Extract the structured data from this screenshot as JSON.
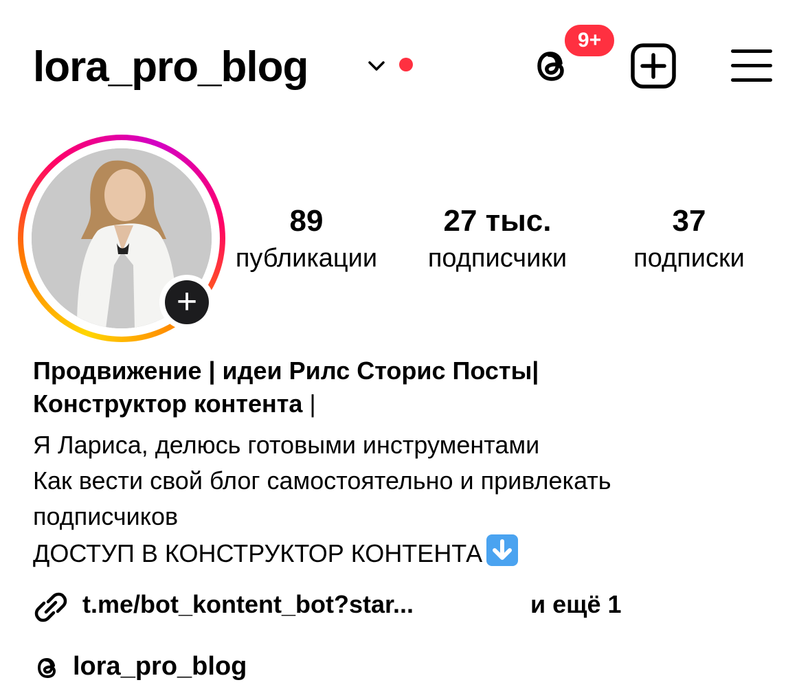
{
  "header": {
    "username": "lora_pro_blog",
    "notification_badge": "9+",
    "icons": {
      "account_switch": "chevron-down-icon",
      "threads": "threads-icon",
      "create": "plus-square-icon",
      "menu": "hamburger-menu-icon"
    },
    "colors": {
      "accent_red": "#ff3040"
    }
  },
  "profile": {
    "avatar_icon": "profile-avatar",
    "add_story_symbol": "+"
  },
  "stats": {
    "posts": {
      "value": "89",
      "label": "публикации"
    },
    "followers": {
      "value": "27 тыс.",
      "label": "подписчики"
    },
    "following": {
      "value": "37",
      "label": "подписки"
    }
  },
  "bio": {
    "name_line1": "Продвижение | идеи Рилс Сторис Посты|",
    "name_line2": "Конструктор контента",
    "name_line2_suffix": " |",
    "lines": [
      "Я Лариса, делюсь готовыми инструментами",
      "Как вести свой блог самостоятельно и привлекать",
      "подписчиков",
      "ДОСТУП В КОНСТРУКТОР КОНТЕНТА"
    ],
    "emoji_icon": "down-arrow-emoji-icon"
  },
  "link": {
    "icon": "link-icon",
    "text": "t.me/bot_kontent_bot?star...",
    "more": "и ещё 1"
  },
  "threads_profile": {
    "icon": "threads-icon",
    "handle": "lora_pro_blog"
  }
}
